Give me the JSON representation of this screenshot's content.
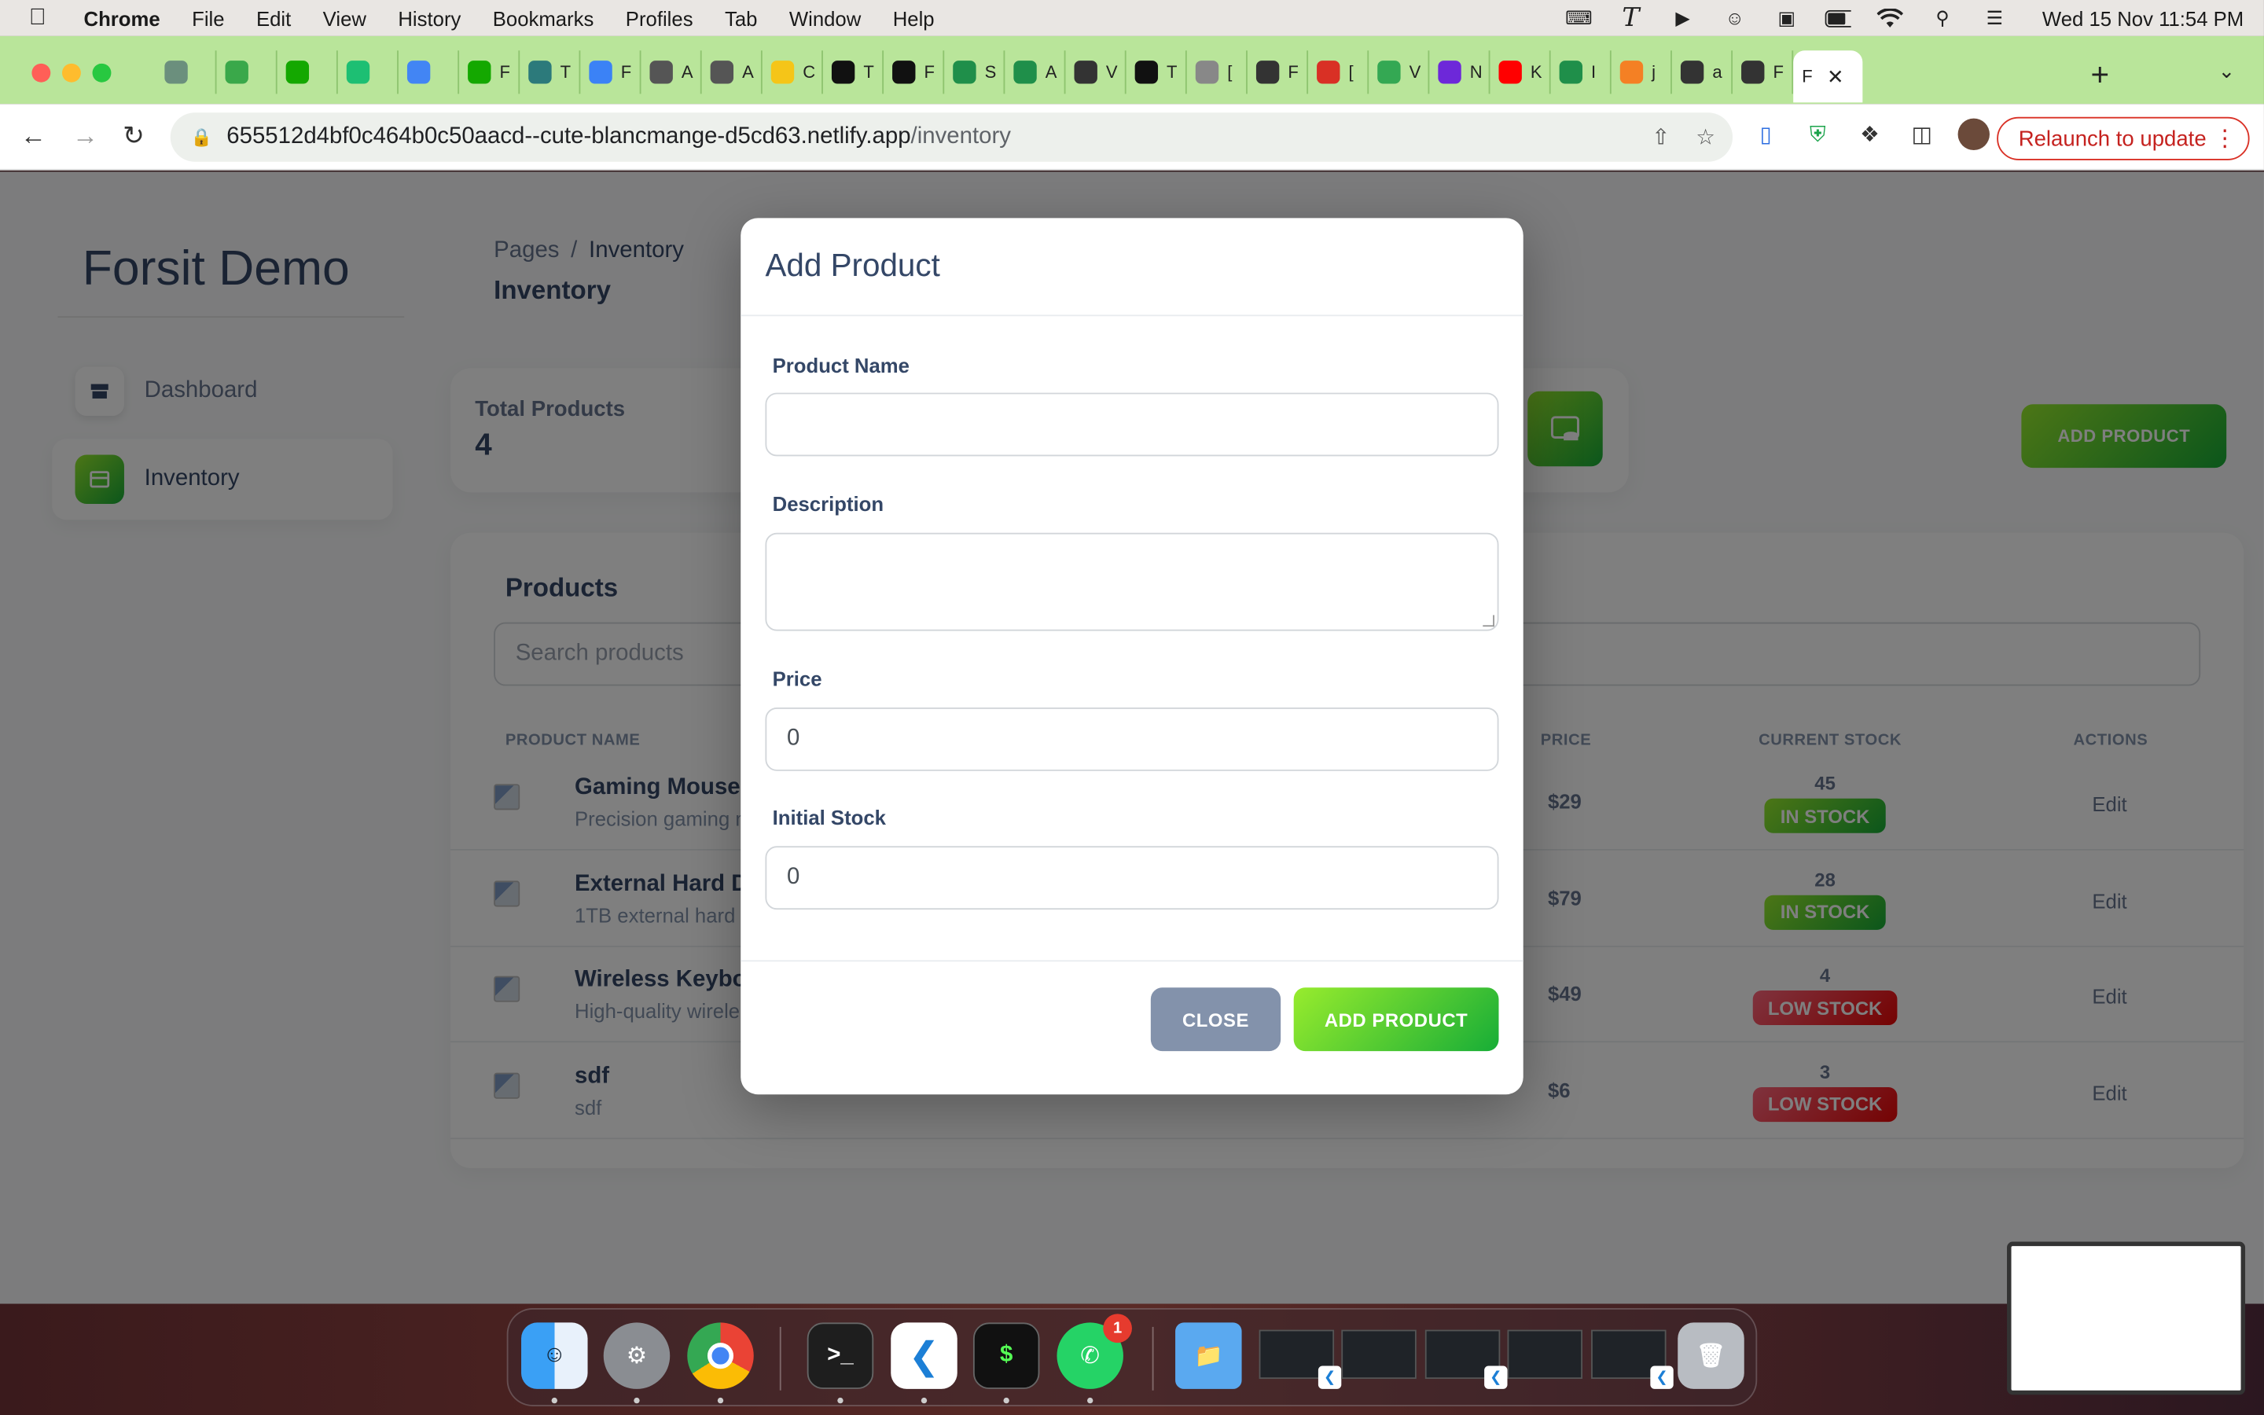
{
  "menubar": {
    "app": "Chrome",
    "items": [
      "File",
      "Edit",
      "View",
      "History",
      "Bookmarks",
      "Profiles",
      "Tab",
      "Window",
      "Help"
    ],
    "clock": "Wed 15 Nov  11:54 PM"
  },
  "tabs": {
    "items": [
      {
        "icon": "chatgpt-icon",
        "label": "",
        "color": "#6b8f7d"
      },
      {
        "icon": "badge-2-icon",
        "label": "",
        "color": "#3aa84a"
      },
      {
        "icon": "upwork-icon",
        "label": "",
        "color": "#14a800"
      },
      {
        "icon": "fiverr-icon",
        "label": "",
        "color": "#1dbf73"
      },
      {
        "icon": "google-icon",
        "label": "",
        "color": "#4285f4"
      },
      {
        "icon": "upwork-icon",
        "label": "F",
        "color": "#14a800"
      },
      {
        "icon": "tab-icon",
        "label": "T",
        "color": "#2c7a7b"
      },
      {
        "icon": "plane-icon",
        "label": "F",
        "color": "#3b82f6"
      },
      {
        "icon": "apple-icon",
        "label": "A",
        "color": "#555555"
      },
      {
        "icon": "apple-icon",
        "label": "A",
        "color": "#555555"
      },
      {
        "icon": "note-icon",
        "label": "C",
        "color": "#f5c518"
      },
      {
        "icon": "t-icon",
        "label": "T",
        "color": "#111111"
      },
      {
        "icon": "next-icon",
        "label": "F",
        "color": "#111111"
      },
      {
        "icon": "house-icon",
        "label": "S",
        "color": "#1f8f4a"
      },
      {
        "icon": "house-icon",
        "label": "A",
        "color": "#1f8f4a"
      },
      {
        "icon": "building-icon",
        "label": "V",
        "color": "#333333"
      },
      {
        "icon": "bowtie-icon",
        "label": "T",
        "color": "#111111"
      },
      {
        "icon": "globe-icon",
        "label": "[",
        "color": "#888888"
      },
      {
        "icon": "building-icon",
        "label": "F",
        "color": "#333333"
      },
      {
        "icon": "gmail-icon",
        "label": "[",
        "color": "#d93025"
      },
      {
        "icon": "play-icon",
        "label": "V",
        "color": "#34a853"
      },
      {
        "icon": "b-icon",
        "label": "N",
        "color": "#6d28d9"
      },
      {
        "icon": "youtube-icon",
        "label": "K",
        "color": "#ff0000"
      },
      {
        "icon": "r-icon",
        "label": "I",
        "color": "#1f8f4a"
      },
      {
        "icon": "stack-icon",
        "label": "j",
        "color": "#f48024"
      },
      {
        "icon": "github-icon",
        "label": "a",
        "color": "#333333"
      },
      {
        "icon": "building-icon",
        "label": "F",
        "color": "#333333"
      }
    ],
    "active_label": "F"
  },
  "toolbar": {
    "url_host": "655512d4bf0c464b0c50aacd--cute-blancmange-d5cd63.netlify.app",
    "url_path": "/inventory",
    "relaunch": "Relaunch to update"
  },
  "sidebar": {
    "brand": "Forsit Demo",
    "items": [
      {
        "label": "Dashboard"
      },
      {
        "label": "Inventory"
      }
    ]
  },
  "header": {
    "breadcrumb_root": "Pages",
    "breadcrumb_sep": "/",
    "breadcrumb_current": "Inventory",
    "title": "Inventory"
  },
  "stats": {
    "total_label": "Total Products",
    "total_value": "4"
  },
  "add_product_button": "ADD PRODUCT",
  "products": {
    "heading": "Products",
    "search_placeholder": "Search products",
    "columns": {
      "name": "PRODUCT NAME",
      "price": "PRICE",
      "stock": "CURRENT STOCK",
      "actions": "ACTIONS"
    },
    "rows": [
      {
        "name": "Gaming Mouse",
        "desc": "Precision gaming m",
        "price": "$29",
        "stock": "45",
        "status": "IN STOCK",
        "action": "Edit"
      },
      {
        "name": "External Hard D",
        "desc": "1TB external hard d",
        "price": "$79",
        "stock": "28",
        "status": "IN STOCK",
        "action": "Edit"
      },
      {
        "name": "Wireless Keyboa",
        "desc": "High-quality wirele",
        "price": "$49",
        "stock": "4",
        "status": "LOW STOCK",
        "action": "Edit"
      },
      {
        "name": "sdf",
        "desc": "sdf",
        "price": "$6",
        "stock": "3",
        "status": "LOW STOCK",
        "action": "Edit"
      }
    ]
  },
  "modal": {
    "title": "Add Product",
    "product_name_label": "Product Name",
    "product_name_value": "",
    "description_label": "Description",
    "description_value": "",
    "price_label": "Price",
    "price_value": "0",
    "stock_label": "Initial Stock",
    "stock_value": "0",
    "close_button": "CLOSE",
    "submit_button": "ADD PRODUCT"
  },
  "dock": {
    "whatsapp_badge": "1"
  },
  "colors": {
    "accent_green": "#82d616",
    "in_stock": "#4caf50",
    "low_stock": "#ea0606",
    "close_button": "#8392ab"
  }
}
